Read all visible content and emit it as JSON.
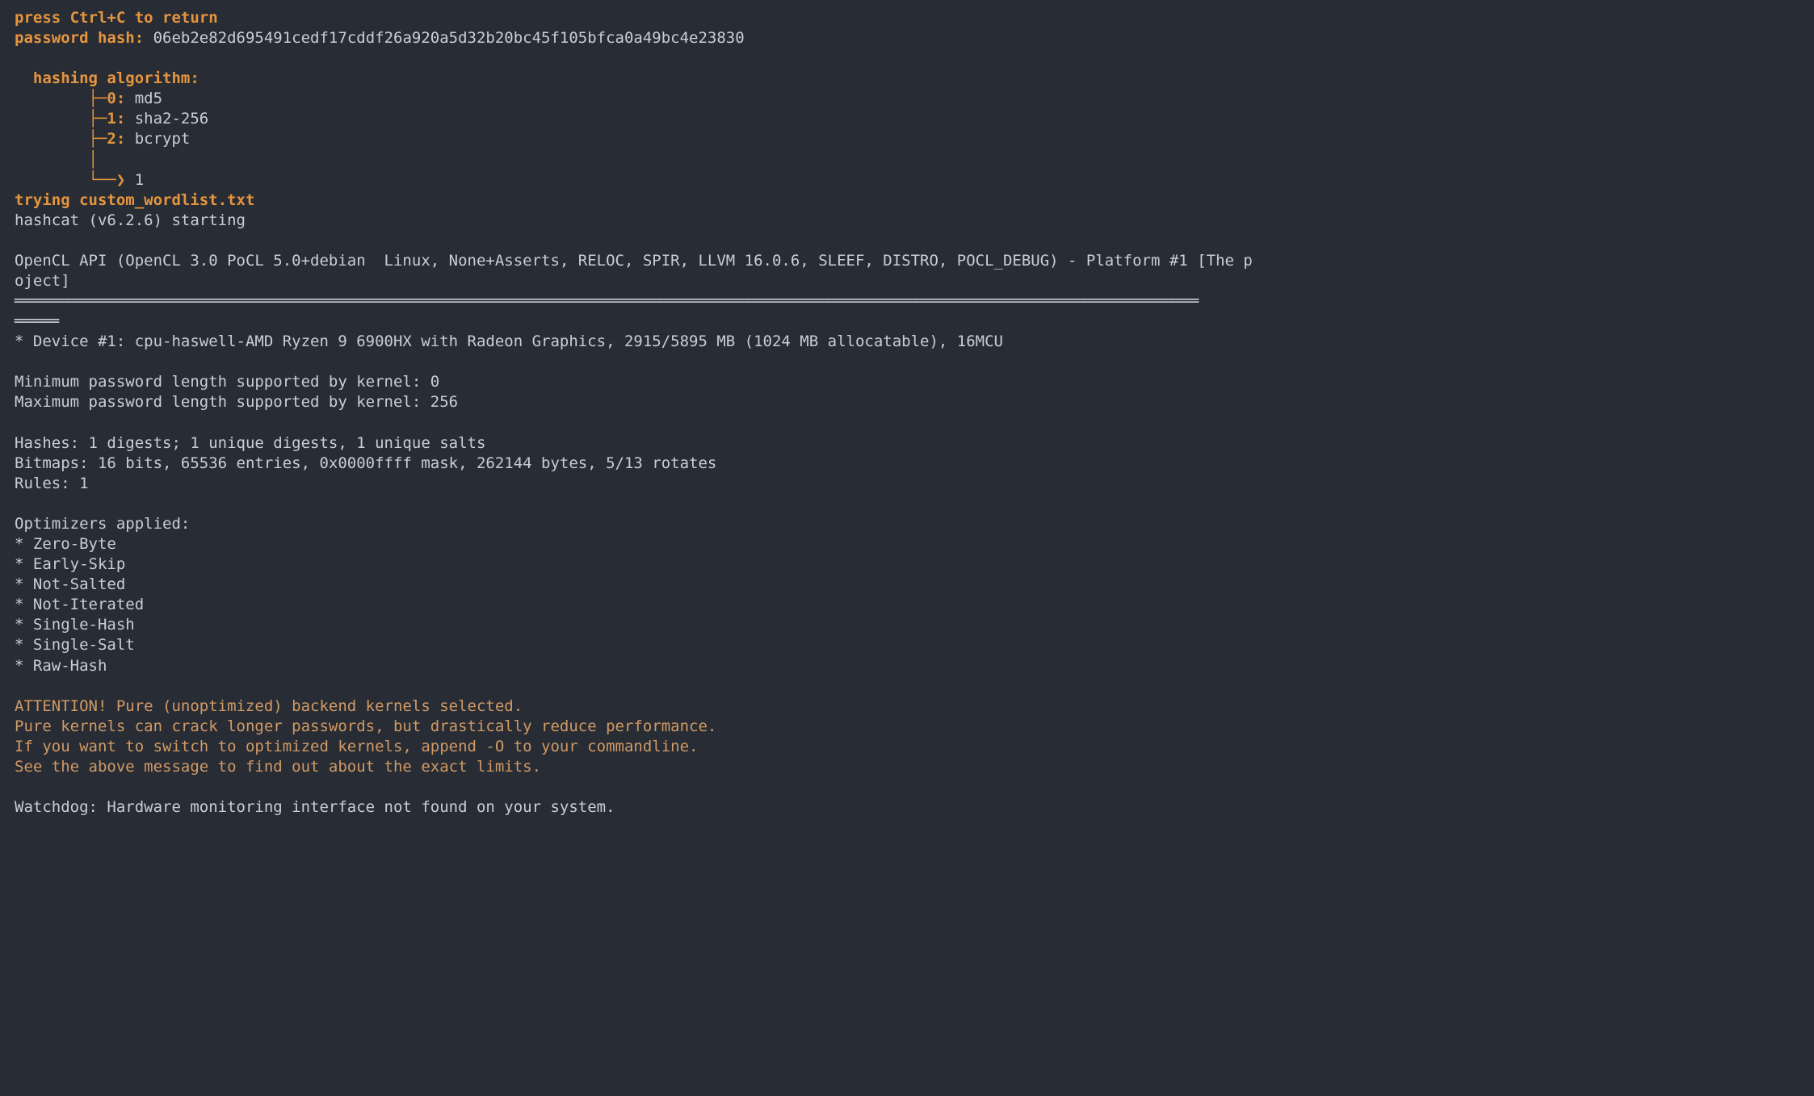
{
  "header": {
    "ctrlc_hint": "press Ctrl+C to return",
    "password_hash_label": "password hash:",
    "password_hash_value": " 06eb2e82d695491cedf17cddf26a920a5d32b20bc45f105bfca0a49bc4e23830",
    "algo_header": "  hashing algorithm:",
    "algo_opts": [
      {
        "prefix": "        ├─",
        "idx": "0:",
        "name": " md5"
      },
      {
        "prefix": "        ├─",
        "idx": "1:",
        "name": " sha2-256"
      },
      {
        "prefix": "        ├─",
        "idx": "2:",
        "name": " bcrypt"
      }
    ],
    "algo_pipe": "        │",
    "algo_prompt_prefix": "        └──❯ ",
    "algo_prompt_value": "1",
    "trying_line": "trying custom_wordlist.txt"
  },
  "hashcat": {
    "start": "hashcat (v6.2.6) starting",
    "opencl": "OpenCL API (OpenCL 3.0 PoCL 5.0+debian  Linux, None+Asserts, RELOC, SPIR, LLVM 16.0.6, SLEEF, DISTRO, POCL_DEBUG) - Platform #1 [The p",
    "opencl2": "oject]",
    "rule1": "══════════════════════════════════════════════════════════════════════════════════════════════════════════════════════════════════════",
    "rule2": "═════",
    "device": "* Device #1: cpu-haswell-AMD Ryzen 9 6900HX with Radeon Graphics, 2915/5895 MB (1024 MB allocatable), 16MCU",
    "minlen": "Minimum password length supported by kernel: 0",
    "maxlen": "Maximum password length supported by kernel: 256",
    "hashes": "Hashes: 1 digests; 1 unique digests, 1 unique salts",
    "bitmaps": "Bitmaps: 16 bits, 65536 entries, 0x0000ffff mask, 262144 bytes, 5/13 rotates",
    "rules": "Rules: 1",
    "opt_hdr": "Optimizers applied:",
    "opts": [
      "* Zero-Byte",
      "* Early-Skip",
      "* Not-Salted",
      "* Not-Iterated",
      "* Single-Hash",
      "* Single-Salt",
      "* Raw-Hash"
    ],
    "attn1": "ATTENTION! Pure (unoptimized) backend kernels selected.",
    "attn2": "Pure kernels can crack longer passwords, but drastically reduce performance.",
    "attn3": "If you want to switch to optimized kernels, append -O to your commandline.",
    "attn4": "See the above message to find out about the exact limits.",
    "watchdog": "Watchdog: Hardware monitoring interface not found on your system."
  }
}
